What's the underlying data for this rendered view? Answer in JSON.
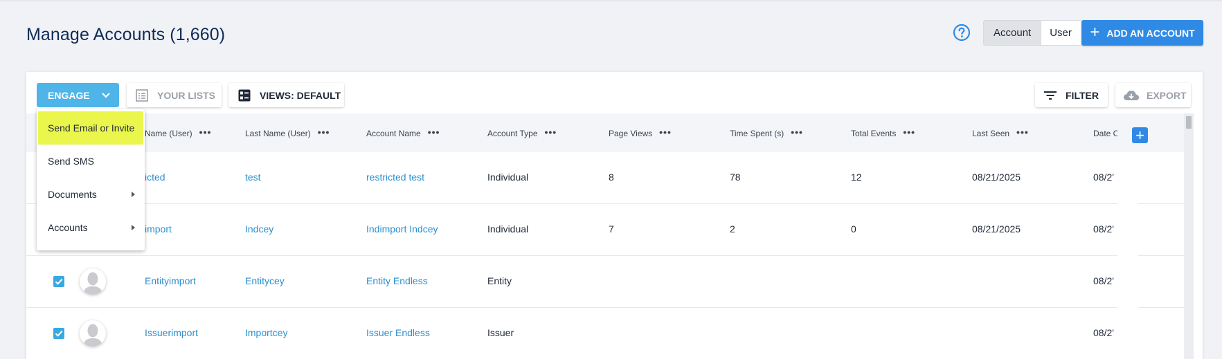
{
  "page": {
    "title": "Manage Accounts (1,660)"
  },
  "header": {
    "help_icon": "help-circle-icon",
    "toggle": {
      "account": "Account",
      "user": "User",
      "active": "Account"
    },
    "add_button": "ADD AN ACCOUNT"
  },
  "toolbar": {
    "engage": "ENGAGE",
    "your_lists": "YOUR LISTS",
    "views": "VIEWS: DEFAULT",
    "filter": "FILTER",
    "export": "EXPORT"
  },
  "engage_menu": {
    "items": [
      {
        "label": "Send Email or Invite",
        "submenu": false,
        "highlighted": true
      },
      {
        "label": "Send SMS",
        "submenu": false
      },
      {
        "label": "Documents",
        "submenu": true
      },
      {
        "label": "Accounts",
        "submenu": true
      }
    ]
  },
  "table": {
    "columns": [
      "First Name (User)",
      "Last Name (User)",
      "Account Name",
      "Account Type",
      "Page Views",
      "Time Spent (s)",
      "Total Events",
      "Last Seen",
      "Date C"
    ],
    "visible_column_labels": [
      "Name (User)",
      "Last Name (User)",
      "Account Name",
      "Account Type",
      "Page Views",
      "Time Spent (s)",
      "Total Events",
      "Last Seen",
      "Date C"
    ],
    "rows": [
      {
        "first": "icted",
        "last": "test",
        "account": "restricted test",
        "type": "Individual",
        "views": "8",
        "time": "78",
        "events": "12",
        "last_seen": "08/21/2025",
        "date_c": "08/2'"
      },
      {
        "first": "import",
        "last": "Indcey",
        "account": "Indimport Indcey",
        "type": "Individual",
        "views": "7",
        "time": "2",
        "events": "0",
        "last_seen": "08/21/2025",
        "date_c": "08/2'"
      },
      {
        "first": "Entityimport",
        "last": "Entitycey",
        "account": "Entity Endless",
        "type": "Entity",
        "views": "",
        "time": "",
        "events": "",
        "last_seen": "",
        "date_c": "08/2'"
      },
      {
        "first": "Issuerimport",
        "last": "Importcey",
        "account": "Issuer Endless",
        "type": "Issuer",
        "views": "",
        "time": "",
        "events": "",
        "last_seen": "",
        "date_c": "08/2'"
      }
    ]
  },
  "colors": {
    "primary": "#2f8ae6",
    "engage": "#4fb4e8",
    "link": "#2a8fd0",
    "highlight": "#eaf64c",
    "title": "#102a56"
  }
}
